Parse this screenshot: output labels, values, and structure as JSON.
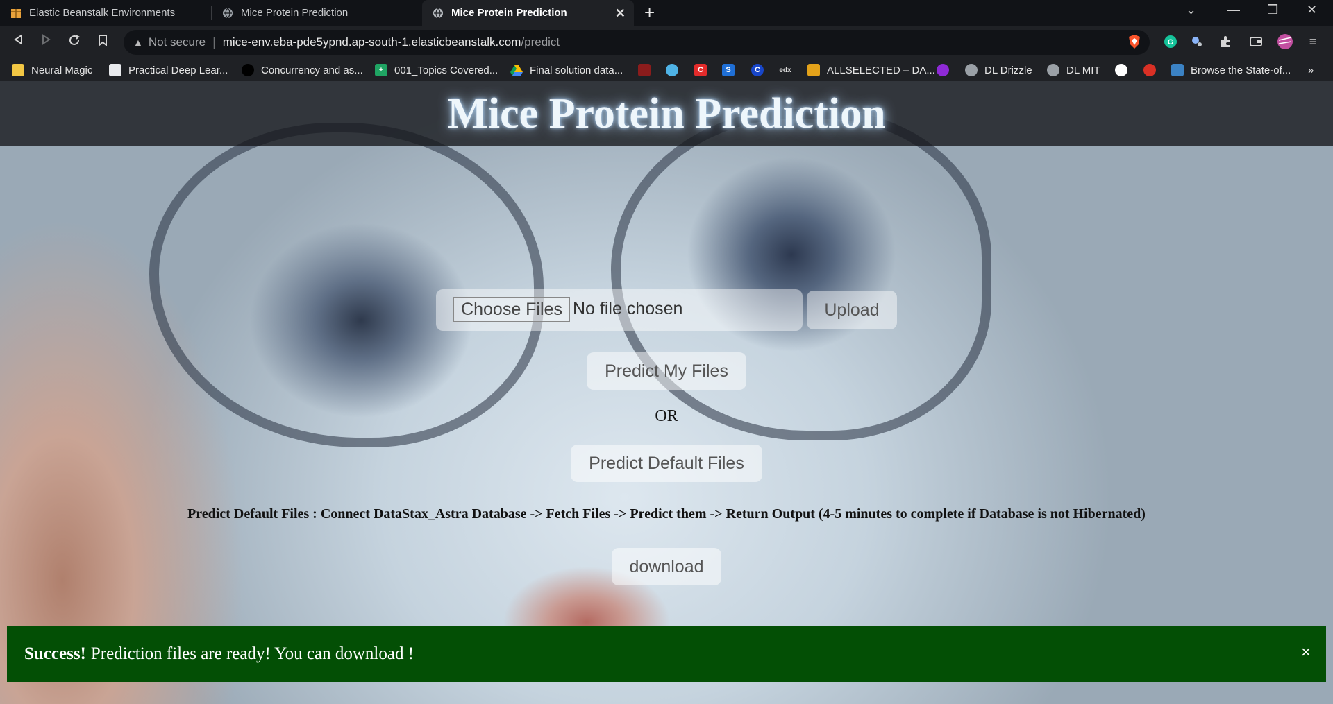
{
  "tabs": [
    {
      "label": "Elastic Beanstalk Environments",
      "icon": "aws-box-icon"
    },
    {
      "label": "Mice Protein Prediction",
      "icon": "globe-icon"
    },
    {
      "label": "Mice Protein Prediction",
      "icon": "globe-icon",
      "active": true
    }
  ],
  "omnibox": {
    "security": "Not secure",
    "host": "mice-env.eba-pde5ypnd.ap-south-1.elasticbeanstalk.com",
    "path": "/predict"
  },
  "bookmarks": [
    {
      "label": "Neural Magic",
      "icon": "folder-icon"
    },
    {
      "label": "Practical Deep Lear...",
      "icon": "doc-icon"
    },
    {
      "label": "Concurrency and as...",
      "icon": "site-icon"
    },
    {
      "label": "001_Topics Covered...",
      "icon": "sheets-icon"
    },
    {
      "label": "Final solution data...",
      "icon": "drive-icon"
    },
    {
      "label": "",
      "icon": "site-icon"
    },
    {
      "label": "",
      "icon": "site-icon"
    },
    {
      "label": "",
      "icon": "site-icon",
      "text": "C"
    },
    {
      "label": "",
      "icon": "site-icon",
      "text": "S"
    },
    {
      "label": "",
      "icon": "site-icon",
      "text": "C"
    },
    {
      "label": "",
      "icon": "edx-icon",
      "text": "edx"
    },
    {
      "label": "ALLSELECTED – DA...",
      "icon": "site-icon"
    },
    {
      "label": "",
      "icon": "site-icon"
    },
    {
      "label": "DL Drizzle",
      "icon": "globe-icon"
    },
    {
      "label": "DL MIT",
      "icon": "globe-icon"
    },
    {
      "label": "",
      "icon": "github-icon"
    },
    {
      "label": "",
      "icon": "site-icon"
    },
    {
      "label": "Browse the State-of...",
      "icon": "site-icon"
    }
  ],
  "page": {
    "title": "Mice Protein Prediction",
    "choose_files": "Choose Files",
    "file_status": "No file chosen",
    "upload": "Upload",
    "predict_my_files": "Predict My Files",
    "or": "OR",
    "predict_default_files": "Predict Default Files",
    "description": "Predict Default Files : Connect DataStax_Astra Database -> Fetch Files -> Predict them -> Return Output (4-5 minutes to complete if Database is not Hibernated)",
    "download": "download"
  },
  "alert": {
    "strong": "Success!",
    "message": "Prediction files are ready! You can download !",
    "close": "×",
    "color": "#034f05"
  },
  "colors": {
    "chrome_dark": "#111317",
    "chrome": "#1f2125"
  }
}
